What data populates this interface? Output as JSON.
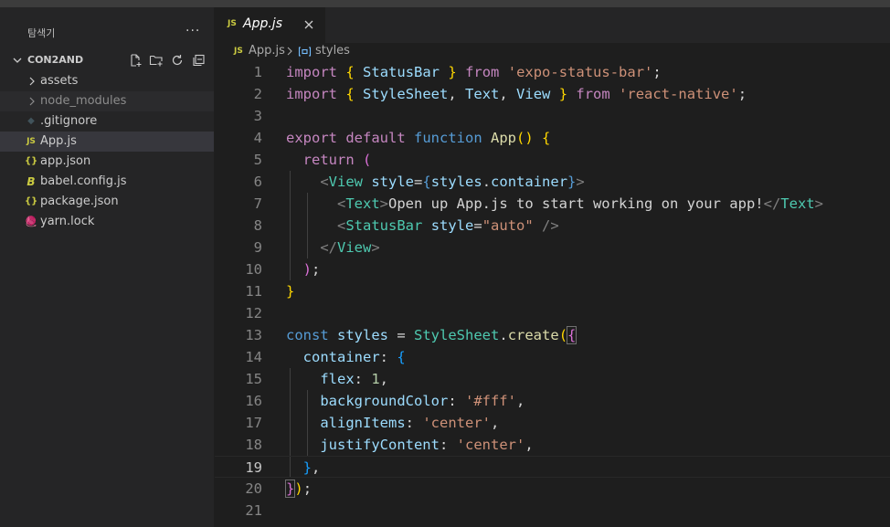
{
  "sidebar": {
    "title": "탐색기",
    "more": "···",
    "project": "CON2AND",
    "items": [
      {
        "label": "assets",
        "kind": "folder"
      },
      {
        "label": "node_modules",
        "kind": "folder"
      },
      {
        "label": ".gitignore",
        "kind": "git",
        "icon": "◆"
      },
      {
        "label": "App.js",
        "kind": "js",
        "icon": "JS"
      },
      {
        "label": "app.json",
        "kind": "json",
        "icon": "{}"
      },
      {
        "label": "babel.config.js",
        "kind": "babel",
        "icon": "B"
      },
      {
        "label": "package.json",
        "kind": "json",
        "icon": "{}"
      },
      {
        "label": "yarn.lock",
        "kind": "yarn",
        "icon": "🧶"
      }
    ]
  },
  "tab": {
    "badge": "JS",
    "name": "App.js"
  },
  "breadcrumb": {
    "badge": "JS",
    "file": "App.js",
    "symbol": "styles"
  },
  "editor": {
    "line_numbers": [
      "1",
      "2",
      "3",
      "4",
      "5",
      "6",
      "7",
      "8",
      "9",
      "10",
      "11",
      "12",
      "13",
      "14",
      "15",
      "16",
      "17",
      "18",
      "19",
      "20",
      "21"
    ],
    "current_line": "19"
  },
  "colors": {
    "keyword": "#c586c0",
    "storage": "#569cd6",
    "function": "#dcdcaa",
    "type": "#4ec9b0",
    "string": "#ce9178",
    "variable": "#9cdcfe",
    "number": "#b5cea8"
  }
}
